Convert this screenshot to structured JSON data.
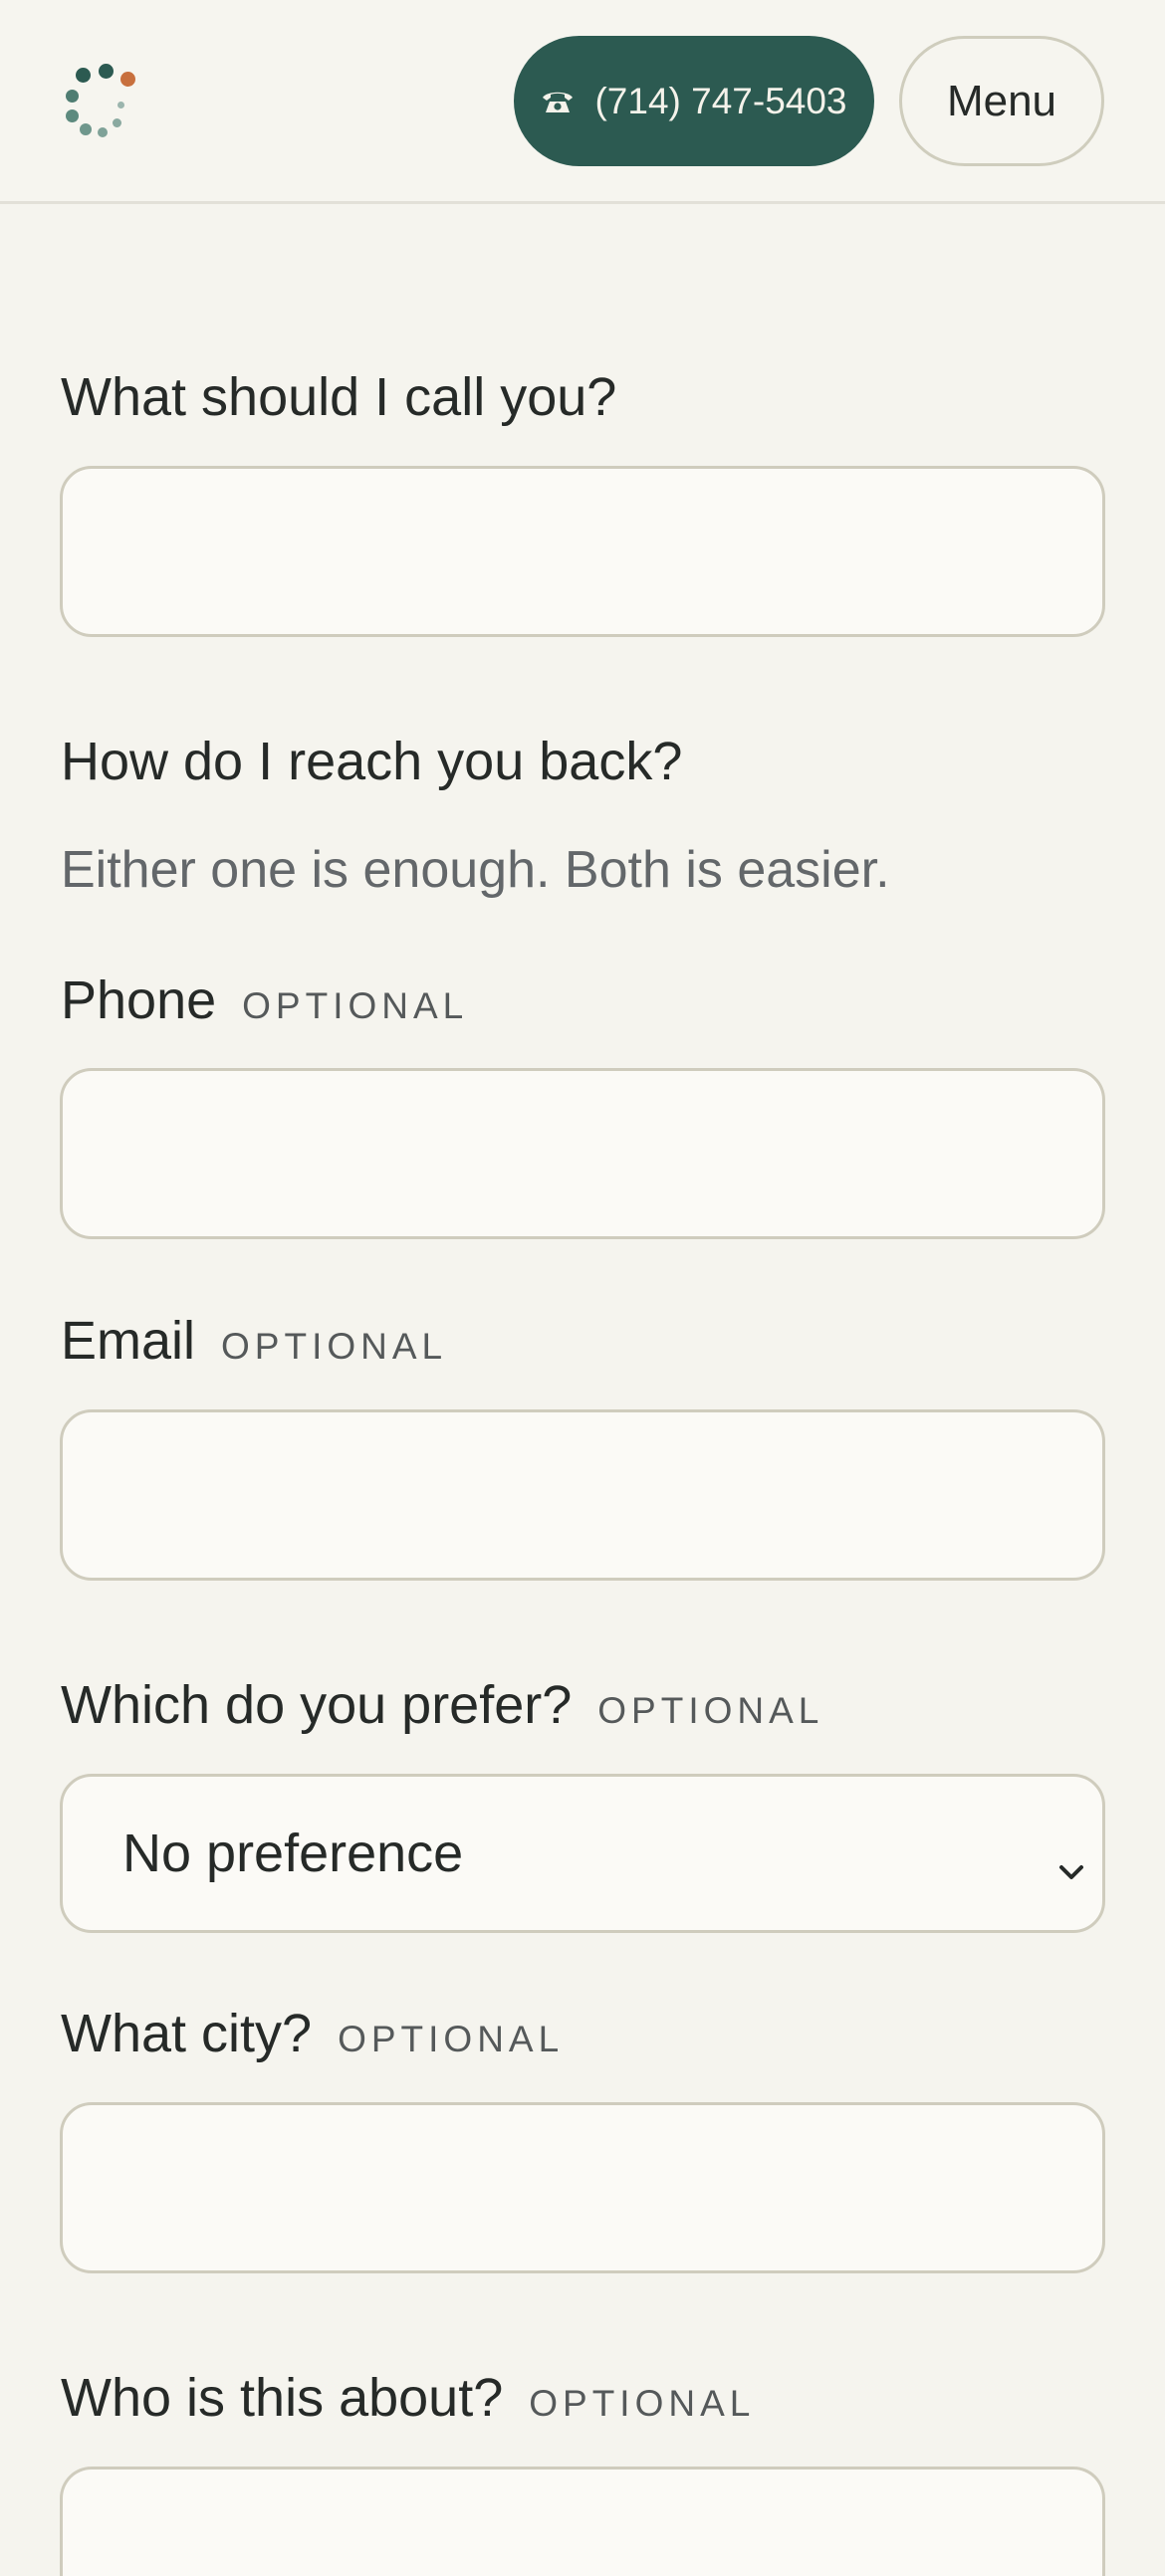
{
  "header": {
    "logo_icon": "dotted-spinner-logo",
    "phone_icon": "telephone-icon",
    "phone_label": "(714) 747-5403",
    "menu_label": "Menu",
    "colors": {
      "brand_green": "#2c5a51",
      "accent_orange": "#c8703e",
      "background": "#f5f4ee"
    }
  },
  "form": {
    "name": {
      "label": "What should I call you?",
      "value": ""
    },
    "contact": {
      "heading": "How do I reach you back?",
      "hint": "Either one is enough. Both is easier."
    },
    "phone": {
      "label": "Phone",
      "optional": "OPTIONAL",
      "value": ""
    },
    "email": {
      "label": "Email",
      "optional": "OPTIONAL",
      "value": ""
    },
    "preference": {
      "label": "Which do you prefer?",
      "optional": "OPTIONAL",
      "selected": "No preference"
    },
    "city": {
      "label": "What city?",
      "optional": "OPTIONAL",
      "value": ""
    },
    "about": {
      "label": "Who is this about?",
      "optional": "OPTIONAL",
      "value": ""
    }
  }
}
